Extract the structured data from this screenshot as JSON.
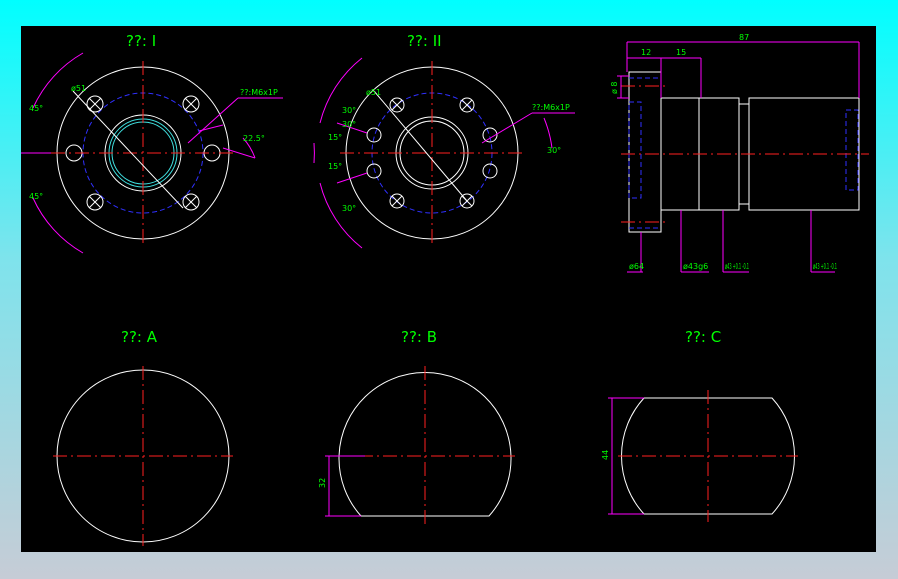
{
  "views": {
    "v1": {
      "title": "??: I",
      "dia": "ø51",
      "thread": "??:M6x1P",
      "a1": "45°",
      "a2": "45°",
      "a3": "22.5°"
    },
    "v2": {
      "title": "??: II",
      "dia": "ø51",
      "thread": "??:M6x1P",
      "a1": "30°",
      "a2": "30°",
      "a3": "15°",
      "a4": "15°",
      "a5": "30°",
      "a6": "30°"
    },
    "v3": {
      "d1": "12",
      "d2": "15",
      "d3": "87",
      "d4": "ø 8",
      "d5": "ø64",
      "d6": "ø43g6",
      "d7": "ø43 +0.1 -0.1",
      "d8": "ø43 +0.1 -0.1"
    },
    "va": {
      "title": "??: A"
    },
    "vb": {
      "title": "??: B",
      "dim": "32"
    },
    "vc": {
      "title": "??: C",
      "dim": "44"
    }
  }
}
